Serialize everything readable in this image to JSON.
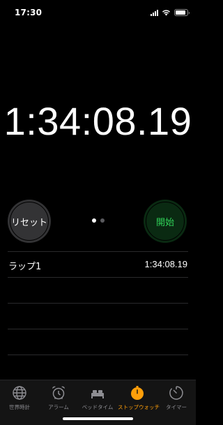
{
  "status_bar": {
    "time": "17:30",
    "battery_level": 0.85
  },
  "stopwatch": {
    "display": "1:34:08.19",
    "reset_label": "リセット",
    "start_label": "開始",
    "start_color": "#30d158",
    "page_dots": 2,
    "active_page": 1
  },
  "laps": [
    {
      "label": "ラップ1",
      "time": "1:34:08.19"
    }
  ],
  "tabs": [
    {
      "label": "世界時計",
      "icon": "globe-icon",
      "active": false
    },
    {
      "label": "アラーム",
      "icon": "alarm-clock-icon",
      "active": false
    },
    {
      "label": "ベッドタイム",
      "icon": "bed-icon",
      "active": false
    },
    {
      "label": "ストップウォッチ",
      "icon": "stopwatch-icon",
      "active": true
    },
    {
      "label": "タイマー",
      "icon": "timer-icon",
      "active": false
    }
  ],
  "colors": {
    "accent": "#ff9f0a",
    "inactive": "#8e8e93",
    "background": "#000000"
  }
}
